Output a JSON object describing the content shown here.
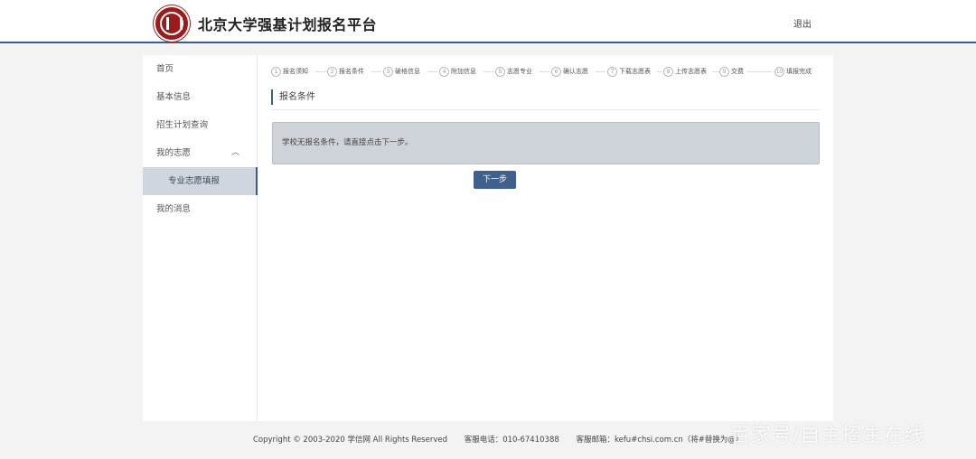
{
  "header": {
    "site_title": "北京大学强基计划报名平台",
    "logout_label": "退出"
  },
  "sidebar": {
    "items": [
      {
        "label": "首页"
      },
      {
        "label": "基本信息"
      },
      {
        "label": "招生计划查询"
      },
      {
        "label": "我的志愿"
      },
      {
        "label": "专业志愿填报"
      },
      {
        "label": "我的消息"
      }
    ],
    "active_item": "专业志愿填报"
  },
  "steps": [
    {
      "num": "1",
      "label": "报名须知"
    },
    {
      "num": "2",
      "label": "报名条件"
    },
    {
      "num": "3",
      "label": "破格信息"
    },
    {
      "num": "4",
      "label": "附加信息"
    },
    {
      "num": "5",
      "label": "志愿专业"
    },
    {
      "num": "6",
      "label": "确认志愿"
    },
    {
      "num": "7",
      "label": "下载志愿表"
    },
    {
      "num": "8",
      "label": "上传志愿表"
    },
    {
      "num": "9",
      "label": "交费"
    },
    {
      "num": "10",
      "label": "填报完成"
    }
  ],
  "main": {
    "section_title": "报名条件",
    "notice_text": "学校无报名条件，请直接点击下一步。",
    "next_button_label": "下一步"
  },
  "footer": {
    "copyright": "Copyright © 2003-2020 学信网 All Rights Reserved",
    "phone": "客服电话：010-67410388",
    "email": "客服邮箱：kefu#chsi.com.cn（将#替换为@）"
  },
  "watermark": "百家号/自主招生在线",
  "colors": {
    "accent": "#3c5d8a",
    "button": "#3f5f8c",
    "notice_bg": "#cdd3d9",
    "logo_red": "#9b1c1c"
  }
}
